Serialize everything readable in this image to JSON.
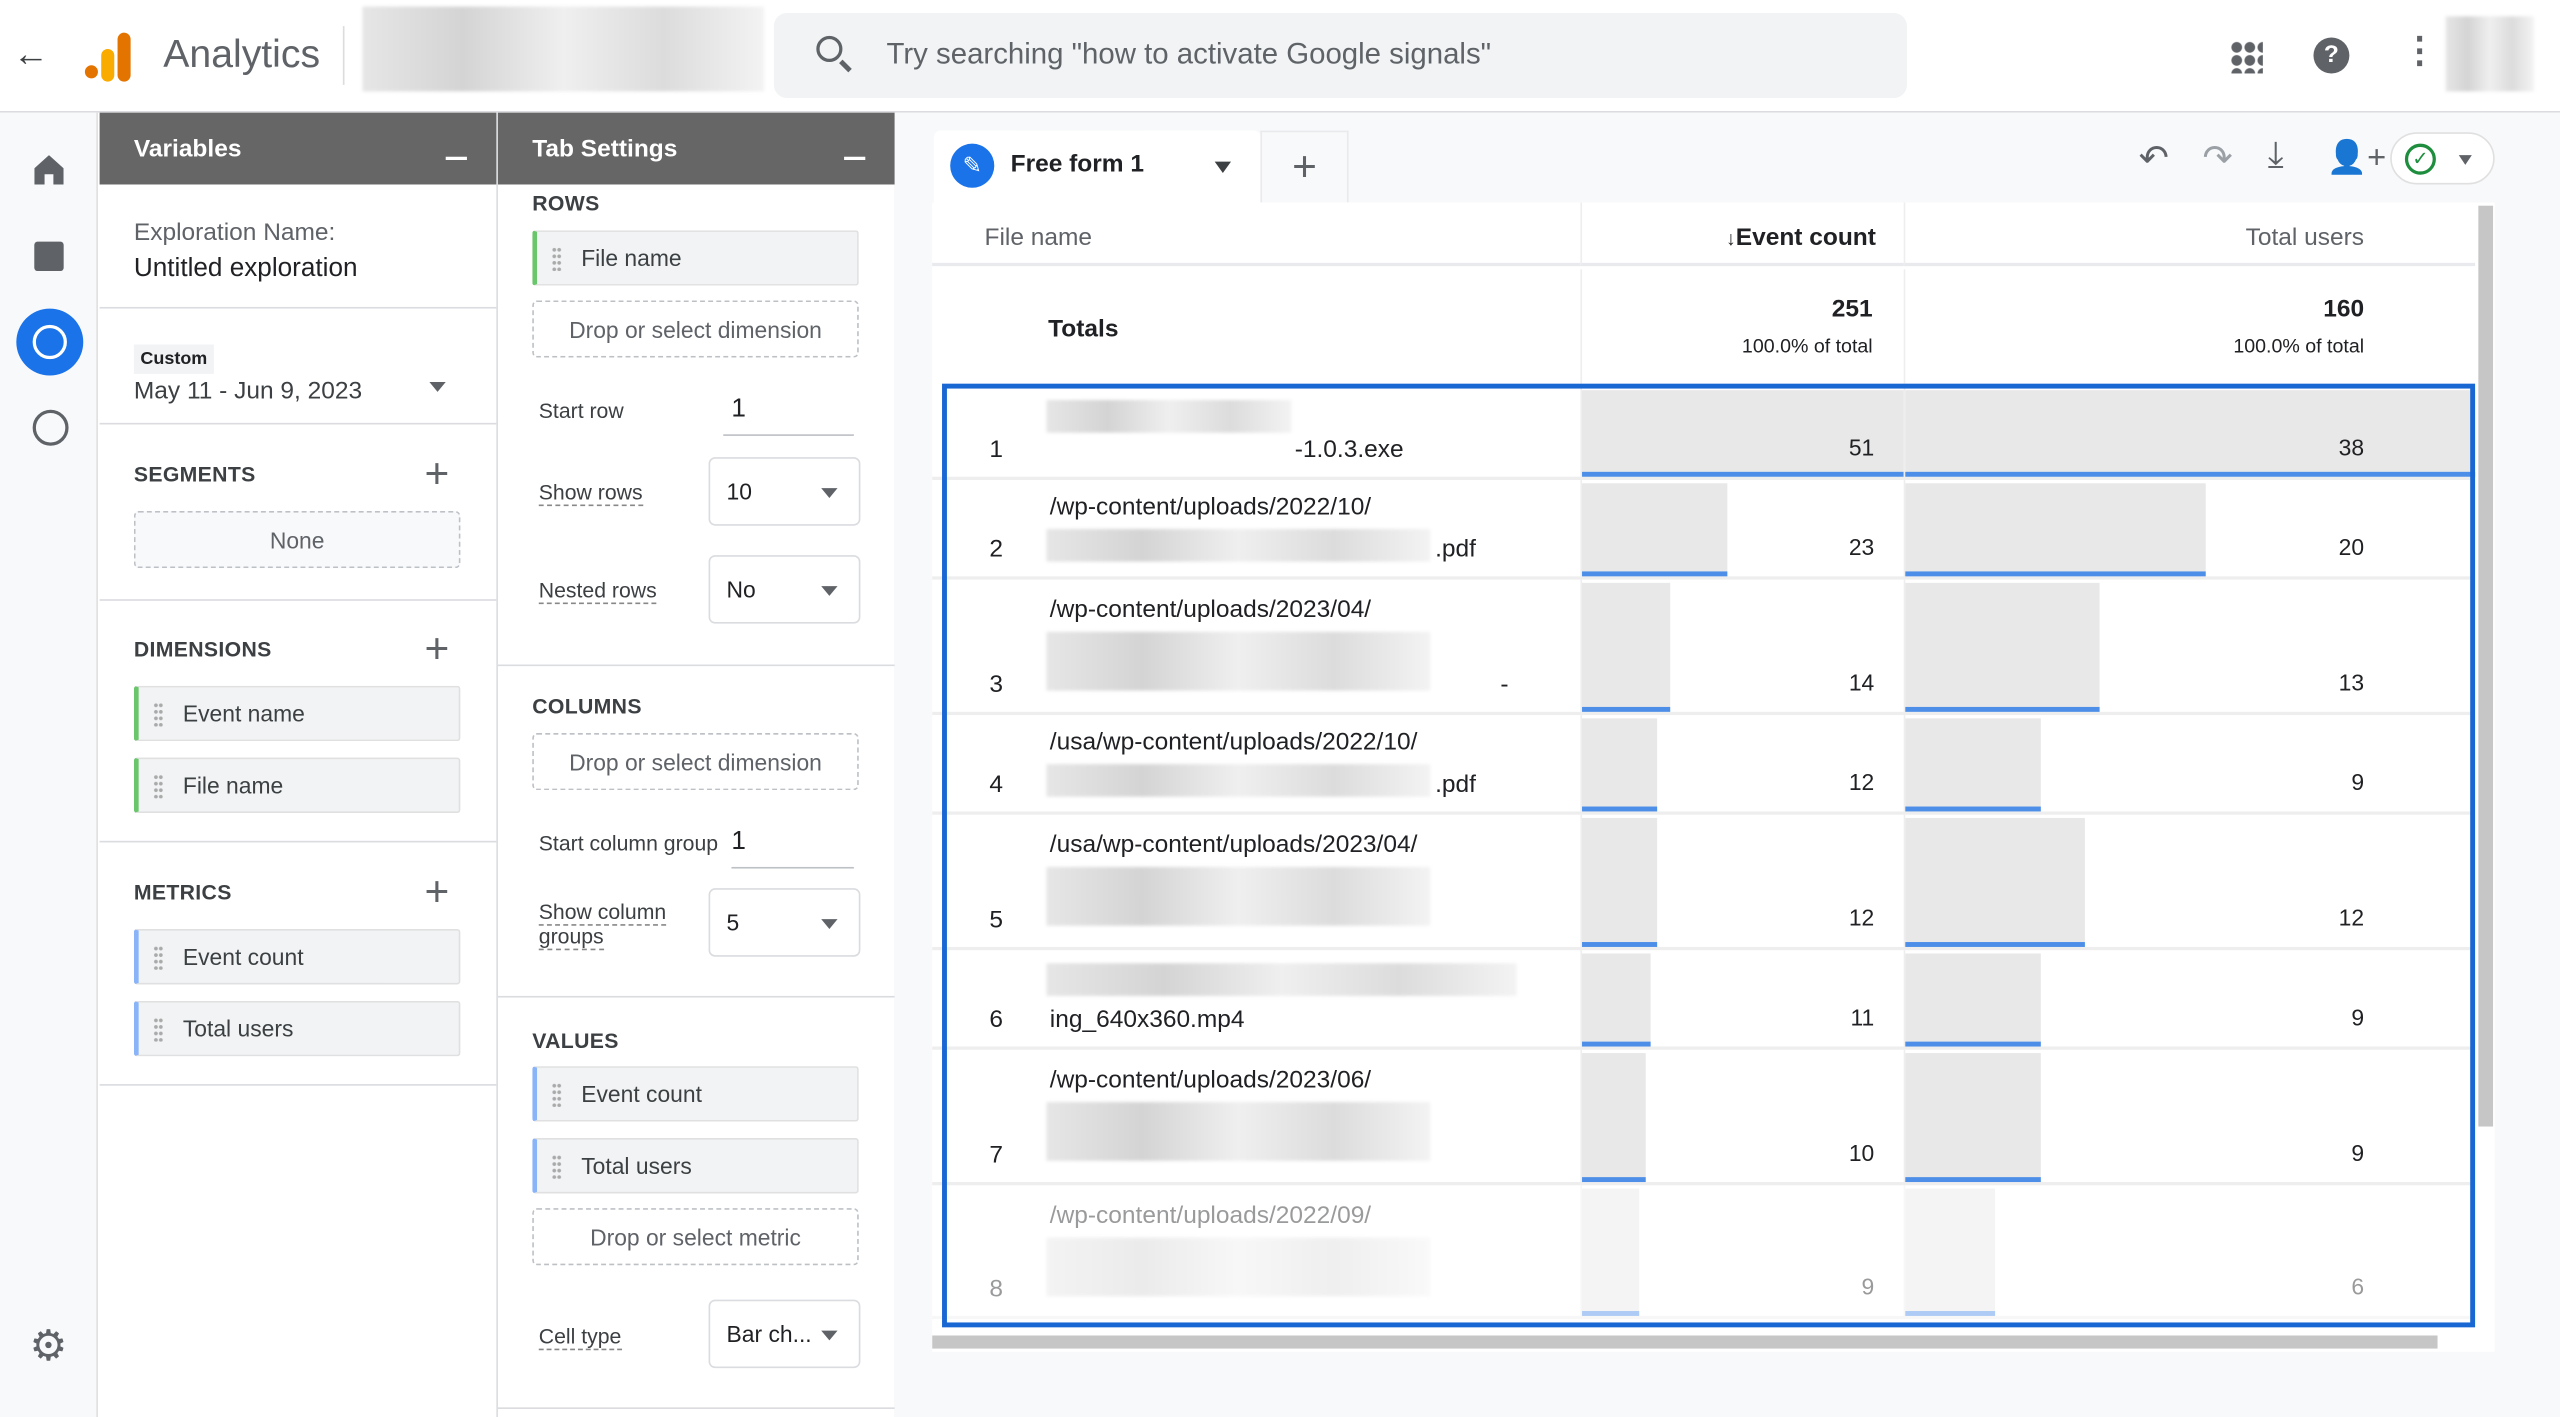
{
  "header": {
    "app_name": "Analytics",
    "search_placeholder": "Try searching \"how to activate Google signals\""
  },
  "colors": {
    "accent": "#1a73e8",
    "dimension_chip": "#6ac66b",
    "metric_chip": "#8ab4f8",
    "panel_header": "#666666"
  },
  "variables": {
    "title": "Variables",
    "exploration_label": "Exploration Name:",
    "exploration_name": "Untitled exploration",
    "date_chip": "Custom",
    "date_range": "May 11 - Jun 9, 2023",
    "segments_title": "SEGMENTS",
    "segments_value": "None",
    "dimensions_title": "DIMENSIONS",
    "dimensions": [
      "Event name",
      "File name"
    ],
    "metrics_title": "METRICS",
    "metrics": [
      "Event count",
      "Total users"
    ]
  },
  "tab_settings": {
    "title": "Tab Settings",
    "rows_title": "ROWS",
    "rows_item": "File name",
    "drop_dimension": "Drop or select dimension",
    "start_row_label": "Start row",
    "start_row": "1",
    "show_rows_label": "Show rows",
    "show_rows": "10",
    "nested_rows_label": "Nested rows",
    "nested_rows": "No",
    "columns_title": "COLUMNS",
    "start_col_label": "Start column group",
    "start_col": "1",
    "show_col_label_1": "Show column",
    "show_col_label_2": "groups",
    "show_col": "5",
    "values_title": "VALUES",
    "values": [
      "Event count",
      "Total users"
    ],
    "drop_metric": "Drop or select metric",
    "cell_type_label": "Cell type",
    "cell_type": "Bar ch..."
  },
  "report": {
    "tab_name": "Free form 1",
    "columns": {
      "file": "File name",
      "event": "Event count",
      "users": "Total users"
    },
    "totals": {
      "label": "Totals",
      "event": "251",
      "users": "160",
      "event_pct": "100.0% of total",
      "users_pct": "100.0% of total"
    },
    "rows": [
      {
        "n": "1",
        "line1": "",
        "line2": "-1.0.3.exe",
        "event": 51,
        "users": 38
      },
      {
        "n": "2",
        "line1": "/wp-content/uploads/2022/10/",
        "line2": ".pdf",
        "event": 23,
        "users": 20
      },
      {
        "n": "3",
        "line1": "/wp-content/uploads/2023/04/",
        "line2": "-",
        "event": 14,
        "users": 13
      },
      {
        "n": "4",
        "line1": "/usa/wp-content/uploads/2022/10/",
        "line2": ".pdf",
        "event": 12,
        "users": 9
      },
      {
        "n": "5",
        "line1": "/usa/wp-content/uploads/2023/04/",
        "line2": "",
        "event": 12,
        "users": 12
      },
      {
        "n": "6",
        "line1": "",
        "line2": "ing_640x360.mp4",
        "event": 11,
        "users": 9
      },
      {
        "n": "7",
        "line1": "/wp-content/uploads/2023/06/",
        "line2": "",
        "event": 10,
        "users": 9
      },
      {
        "n": "8",
        "line1": "/wp-content/uploads/2022/09/",
        "line2": "",
        "event": 9,
        "users": 6
      }
    ]
  }
}
